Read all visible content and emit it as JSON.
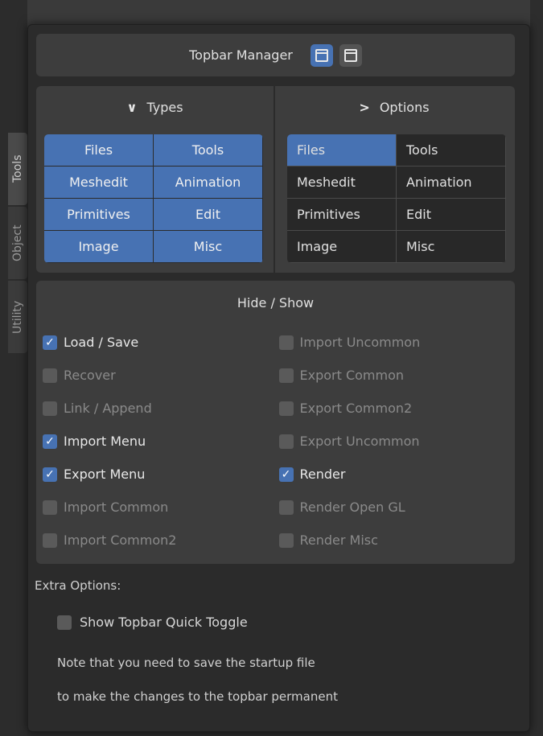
{
  "header": {
    "title": "Topbar Manager",
    "icons": [
      "window-icon",
      "options-panel-icon"
    ]
  },
  "types": {
    "heading": "Types",
    "buttons": [
      "Files",
      "Tools",
      "Meshedit",
      "Animation",
      "Primitives",
      "Edit",
      "Image",
      "Misc"
    ]
  },
  "options": {
    "heading": "Options",
    "buttons": [
      "Files",
      "Tools",
      "Meshedit",
      "Animation",
      "Primitives",
      "Edit",
      "Image",
      "Misc"
    ],
    "selected": "Files"
  },
  "hide_show": {
    "title": "Hide / Show",
    "left": [
      {
        "label": "Load / Save",
        "checked": true
      },
      {
        "label": "Recover",
        "checked": false
      },
      {
        "label": "Link / Append",
        "checked": false
      },
      {
        "label": "Import Menu",
        "checked": true
      },
      {
        "label": "Export Menu",
        "checked": true
      },
      {
        "label": "Import Common",
        "checked": false
      },
      {
        "label": "Import Common2",
        "checked": false
      }
    ],
    "right": [
      {
        "label": "Import Uncommon",
        "checked": false
      },
      {
        "label": "Export Common",
        "checked": false
      },
      {
        "label": "Export Common2",
        "checked": false
      },
      {
        "label": "Export Uncommon",
        "checked": false
      },
      {
        "label": "Render",
        "checked": true
      },
      {
        "label": "Render Open GL",
        "checked": false
      },
      {
        "label": "Render Misc",
        "checked": false
      }
    ]
  },
  "extra": {
    "title": "Extra Options:",
    "toggle_label": "Show Topbar Quick Toggle",
    "toggle_checked": false,
    "note_line1": "Note that you need to save the startup file",
    "note_line2": "to make the changes to the topbar permanent"
  },
  "side_tabs": [
    "Tools",
    "Object",
    "Utility"
  ],
  "colors": {
    "accent": "#4772b3",
    "panel": "#3d3d3d",
    "popup": "#2b2b2b"
  }
}
